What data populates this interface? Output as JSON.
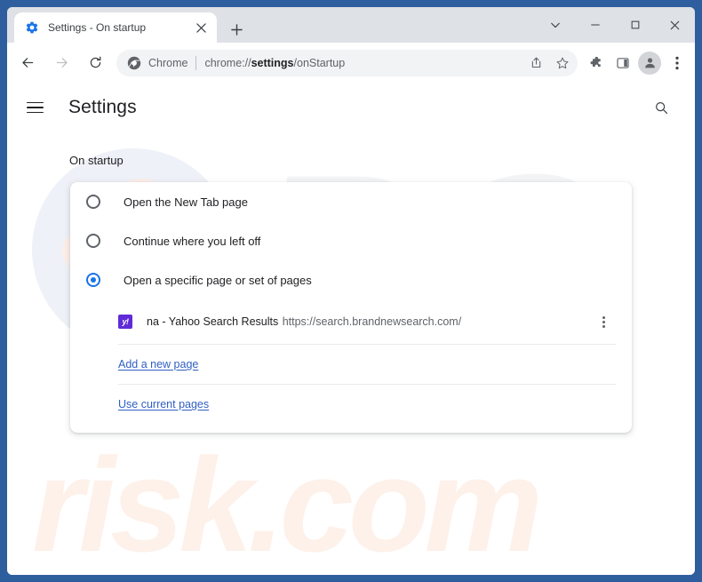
{
  "window": {
    "frame_color": "#2e5e9e",
    "controls": {
      "tab_search_label": "tab-search",
      "minimize_label": "minimize",
      "maximize_label": "maximize",
      "close_label": "close"
    }
  },
  "tabstrip": {
    "active_tab": {
      "title": "Settings - On startup",
      "favicon": "gear-icon",
      "close_label": "×"
    },
    "new_tab_label": "+"
  },
  "toolbar": {
    "back_label": "back",
    "forward_label": "forward",
    "reload_label": "reload",
    "omnibox": {
      "chip_icon": "chrome-icon",
      "chip_label": "Chrome",
      "url_prefix": "chrome://",
      "url_bold": "settings",
      "url_suffix": "/onStartup",
      "share_icon": "share-icon",
      "bookmark_icon": "star-icon"
    },
    "extensions_icon": "puzzle-icon",
    "sidepanel_icon": "side-panel-icon",
    "profile_icon": "person-icon",
    "menu_icon": "three-dots-vertical-icon"
  },
  "settings": {
    "hamburger_icon": "hamburger-menu-icon",
    "title": "Settings",
    "search_icon": "search-icon",
    "section_label": "On startup",
    "options": [
      {
        "label": "Open the New Tab page",
        "selected": false
      },
      {
        "label": "Continue where you left off",
        "selected": false
      },
      {
        "label": "Open a specific page or set of pages",
        "selected": true
      }
    ],
    "startup_pages": [
      {
        "favicon_text": "y!",
        "favicon_color": "#5f2bd6",
        "title": "na - Yahoo Search Results",
        "url": "https://search.brandnewsearch.com/",
        "menu_icon": "three-dots-vertical-icon"
      }
    ],
    "add_new_page_link": "Add a new page",
    "use_current_pages_link": "Use current pages",
    "accent_color": "#1a73e8",
    "link_color": "#2f5fc4"
  },
  "watermarks": {
    "mark_pc": "PC",
    "mark_risk": "risk.com"
  }
}
